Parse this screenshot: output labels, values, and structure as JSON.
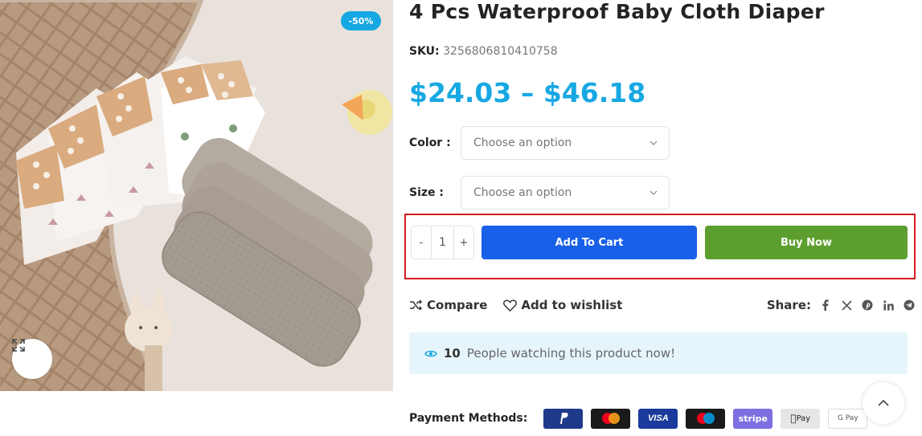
{
  "product": {
    "title": "4 Pcs Waterproof Baby Cloth Diaper",
    "sku_label": "SKU:",
    "sku_value": "3256806810410758",
    "price": "$24.03 – $46.18",
    "sale_badge": "-50%"
  },
  "variations": {
    "color_label": "Color",
    "color_value": "Choose an option",
    "size_label": "Size",
    "size_value": "Choose an option"
  },
  "cart": {
    "decrease": "-",
    "quantity": "1",
    "increase": "+",
    "add_to_cart": "Add To Cart",
    "buy_now": "Buy Now"
  },
  "actions": {
    "compare": "Compare",
    "wishlist": "Add to wishlist",
    "share_label": "Share:"
  },
  "watching": {
    "count": "10",
    "text": "People watching this product now!"
  },
  "payments": {
    "label": "Payment Methods:",
    "methods": [
      "PayPal",
      "Mastercard",
      "VISA",
      "Maestro",
      "stripe",
      "Apple Pay",
      "G Pay"
    ]
  },
  "colors": {
    "accent_blue": "#17a8e3",
    "add_to_cart": "#1960e8",
    "buy_now": "#5d9f2e",
    "highlight_border": "#d31c20",
    "watching_bg": "#e6f5fb"
  }
}
